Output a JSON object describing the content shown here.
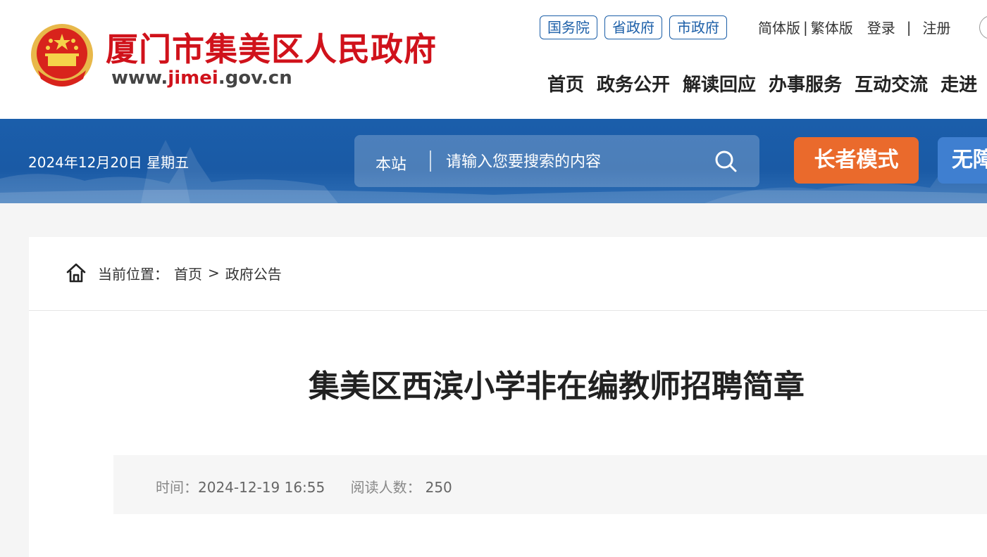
{
  "header": {
    "site_name": "厦门市集美区人民政府",
    "site_url_prefix": "www.",
    "site_url_highlight": "jimei",
    "site_url_suffix": ".gov.cn",
    "gov_links": [
      "国务院",
      "省政府",
      "市政府"
    ],
    "simplified": "简体版",
    "separator1": "|",
    "traditional": "繁体版",
    "login": "登录",
    "separator2": "|",
    "register": "注册",
    "nav": [
      "首页",
      "政务公开",
      "解读回应",
      "办事服务",
      "互动交流",
      "走进"
    ]
  },
  "banner": {
    "date": "2024年12月20日 星期五",
    "search_scope": "本站",
    "search_placeholder": "请输入您要搜索的内容",
    "elder_mode": "长者模式",
    "accessibility": "无障"
  },
  "breadcrumb": {
    "label": "当前位置：",
    "home": "首页",
    "sep": ">",
    "current": "政府公告"
  },
  "article": {
    "title": "集美区西滨小学非在编教师招聘简章",
    "time_label": "时间：",
    "time_value": "2024-12-19 16:55",
    "reads_label": "阅读人数：",
    "reads_value": "250"
  },
  "colors": {
    "brand_red": "#d0121b",
    "banner_blue": "#1b5eab",
    "elder_orange": "#ea6a2c"
  }
}
